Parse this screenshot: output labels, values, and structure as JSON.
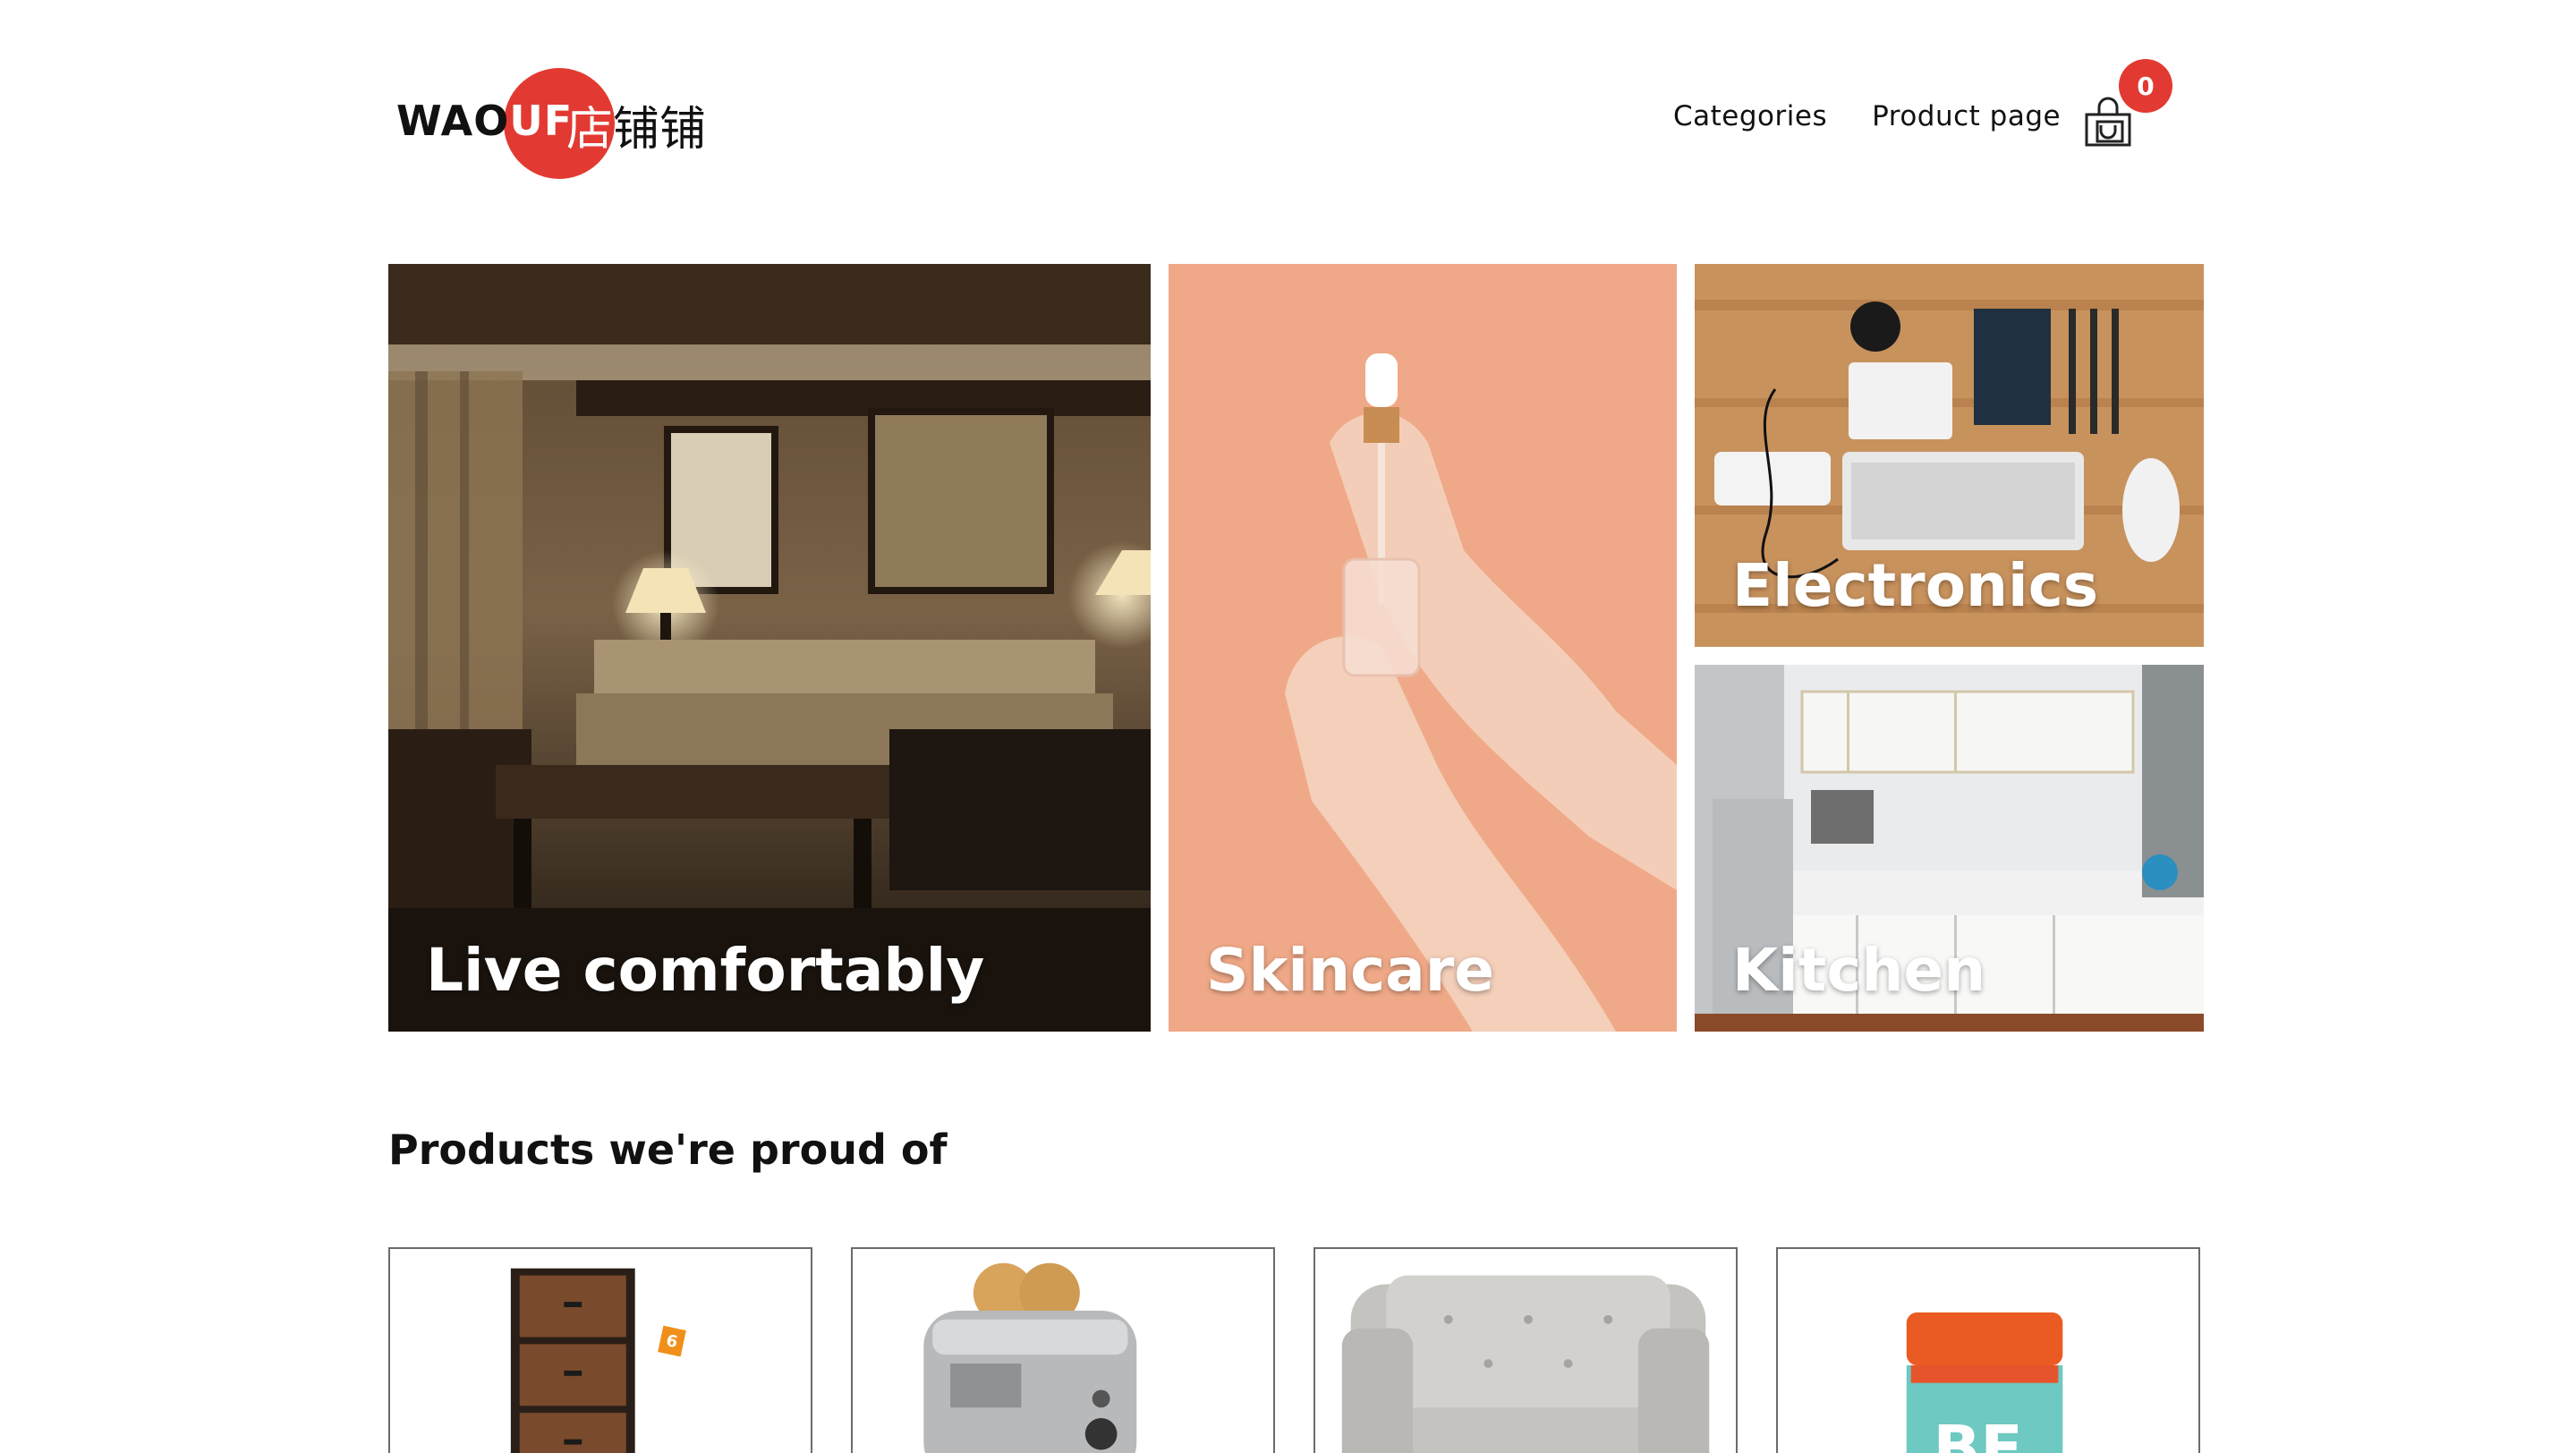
{
  "header": {
    "logo": {
      "text_dark": "WAO",
      "text_red": "UF",
      "text_cn_first": "店",
      "text_cn_rest": "铺铺",
      "accent_color": "#e23a32"
    },
    "nav": [
      {
        "label": "Categories"
      },
      {
        "label": "Product page"
      }
    ],
    "cart": {
      "count": "0",
      "icon": "shopping-bag-icon"
    }
  },
  "hero": {
    "tiles": [
      {
        "label": "Live comfortably",
        "image": "living-room"
      },
      {
        "label": "Skincare",
        "image": "serum-dropper-hands"
      },
      {
        "label": "Electronics",
        "image": "desk-flatlay"
      },
      {
        "label": "Kitchen",
        "image": "kitchen-interior"
      }
    ]
  },
  "products_section": {
    "title": "Products we're proud of",
    "items": [
      {
        "image": "drawer-dresser",
        "badge": "6"
      },
      {
        "image": "toaster"
      },
      {
        "image": "armchair"
      },
      {
        "image": "supplement-bottle"
      }
    ]
  }
}
